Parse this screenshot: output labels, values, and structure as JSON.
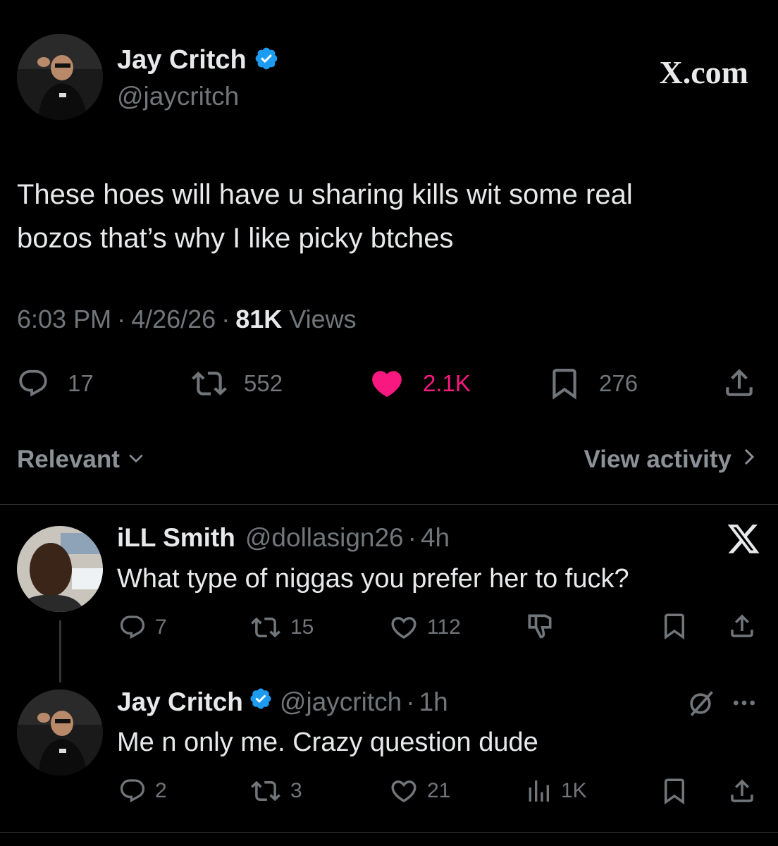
{
  "main_tweet": {
    "author_name": "Jay Critch",
    "handle": "@jaycritch",
    "site_label": "X.com",
    "text_line1": "These hoes will have u sharing kills wit some real",
    "text_line2": "bozos  that’s why I like picky btches",
    "time": "6:03 PM",
    "date": "4/26/26",
    "views_count": "81K",
    "views_label": "Views",
    "replies": "17",
    "reposts": "552",
    "likes": "2.1K",
    "bookmarks": "276",
    "like_color": "#f91880"
  },
  "controls": {
    "sort_label": "Relevant",
    "view_activity": "View activity"
  },
  "reply1": {
    "author_name": "iLL Smith",
    "handle": "@dollasign26",
    "time": "4h",
    "text": "What type of niggas you prefer her to fuck?",
    "replies": "7",
    "reposts": "15",
    "likes": "112"
  },
  "reply2": {
    "author_name": "Jay Critch",
    "handle": "@jaycritch",
    "time": "1h",
    "text": "Me n only me. Crazy question dude",
    "replies": "2",
    "reposts": "3",
    "likes": "21",
    "views": "1K"
  },
  "colors": {
    "background": "#000000",
    "text": "#e7e9ea",
    "secondary": "#71767b",
    "verified": "#1d9bf0",
    "like": "#f91880"
  }
}
